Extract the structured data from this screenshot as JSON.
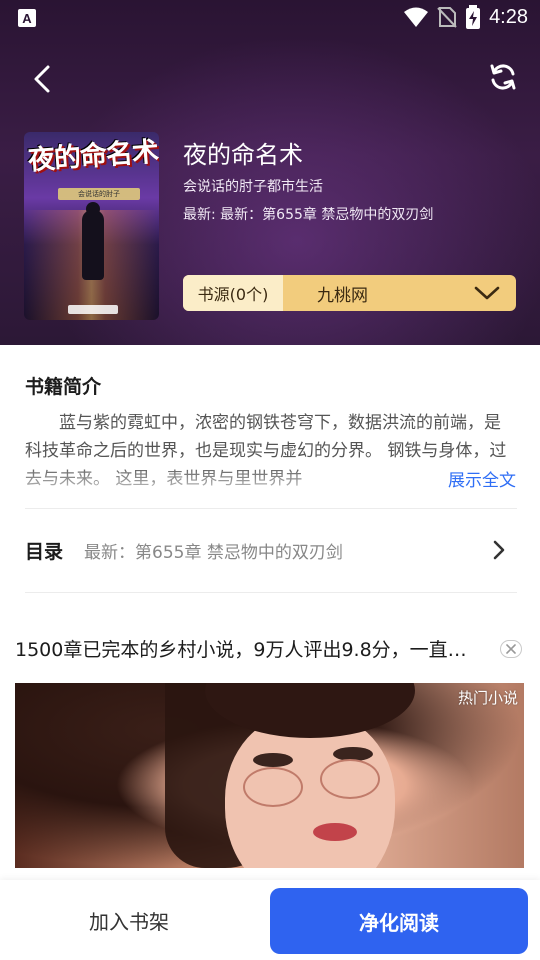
{
  "status_bar": {
    "time": "4:28",
    "icons": [
      "a-notification-icon",
      "wifi-icon",
      "no-sim-icon",
      "battery-charging-icon"
    ]
  },
  "header": {
    "back_icon": "chevron-left-icon",
    "refresh_icon": "refresh-icon"
  },
  "book": {
    "cover_title": "夜的命名术",
    "cover_subtitle": "会说话的肘子",
    "title": "夜的命名术",
    "author_category": "会说话的肘子都市生活",
    "latest": "最新: 最新：第655章 禁忌物中的双刃剑"
  },
  "source": {
    "label": "书源(0个)",
    "value": "九桃网",
    "dropdown_icon": "chevron-down-icon"
  },
  "intro": {
    "heading": "书籍简介",
    "text": "蓝与紫的霓虹中，浓密的钢铁苍穹下，数据洪流的前端，是科技革命之后的世界，也是现实与虚幻的分界。 钢铁与身体，过去与未来。 这里，表世界与里世界并",
    "show_all": "展示全文"
  },
  "toc": {
    "label": "目录",
    "latest": "最新：第655章 禁忌物中的双刃剑",
    "arrow_icon": "chevron-right-icon"
  },
  "ad": {
    "title": "1500章已完本的乡村小说，9万人评出9.8分，一直…",
    "close_icon": "close-icon",
    "tag": "热门小说"
  },
  "bottom": {
    "add_shelf": "加入书架",
    "read": "净化阅读"
  },
  "colors": {
    "accent": "#2f63f0",
    "source_bg": "#f2cc7d",
    "source_label_bg": "#fbedc8",
    "link": "#2f6ef5",
    "header_bg": "#2a1433"
  }
}
